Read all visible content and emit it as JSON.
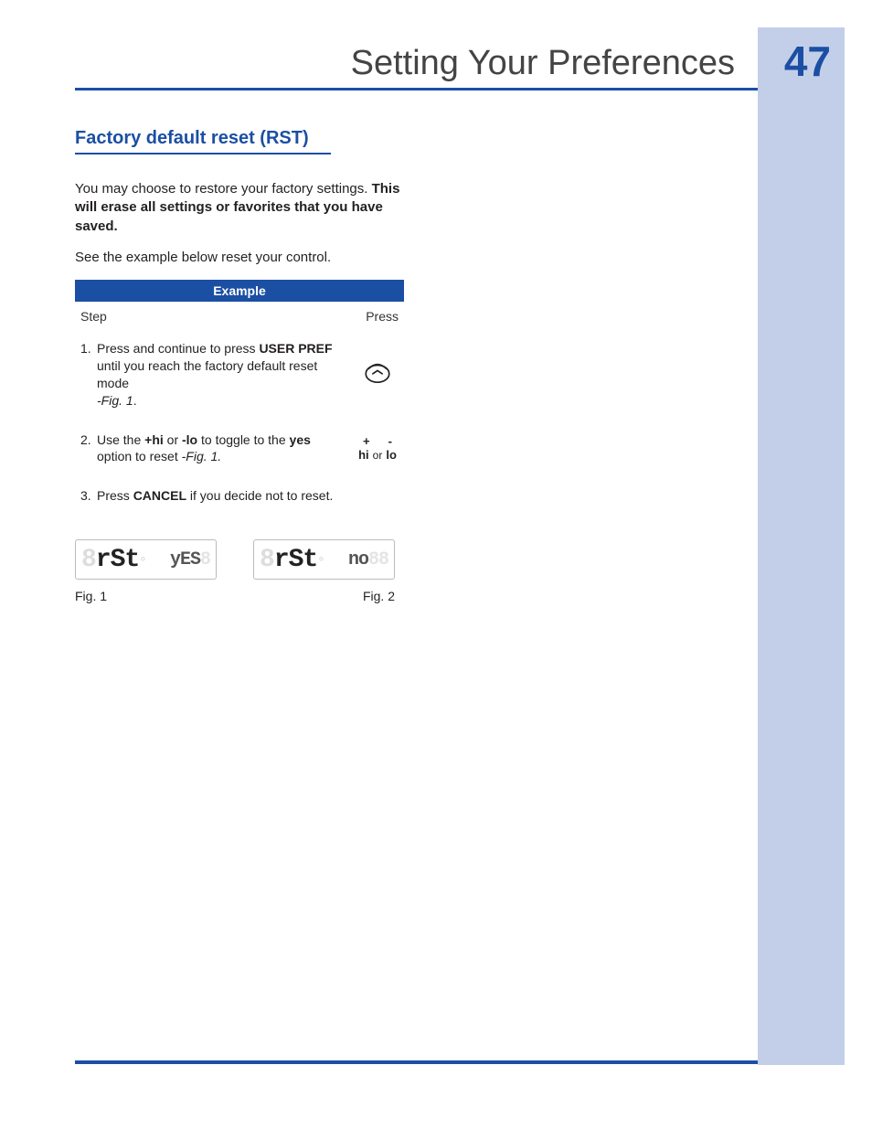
{
  "header": {
    "title": "Setting Your Preferences",
    "page_number": "47"
  },
  "section": {
    "heading": "Factory default reset (RST)",
    "intro_line1": "You may choose to restore your factory settings. ",
    "intro_bold": "This will erase all settings or favorites that you have saved.",
    "intro_line2": "See the example below reset your control."
  },
  "table": {
    "title": "Example",
    "col_step": "Step",
    "col_press": "Press",
    "step1": {
      "num": "1.",
      "a": "Press and continue to press ",
      "b": "USER PREF",
      "c": " until you reach the factory default reset mode ",
      "d": "-Fig. 1",
      "e": "."
    },
    "step2": {
      "num": "2.",
      "a": "Use the ",
      "b": "+hi",
      "c": " or ",
      "d": "-lo",
      "e": " to toggle to the ",
      "f": "yes",
      "g": " option to reset  ",
      "h": "-Fig. 1.",
      "plus": "+",
      "minus": "-",
      "hi": "hi",
      "or": "or",
      "lo": "lo"
    },
    "step3": {
      "num": "3.",
      "a": "Press ",
      "b": "CANCEL",
      "c": " if you decide not to reset."
    }
  },
  "figures": {
    "fig1": {
      "caption": "Fig. 1"
    },
    "fig2": {
      "caption": "Fig. 2"
    }
  }
}
